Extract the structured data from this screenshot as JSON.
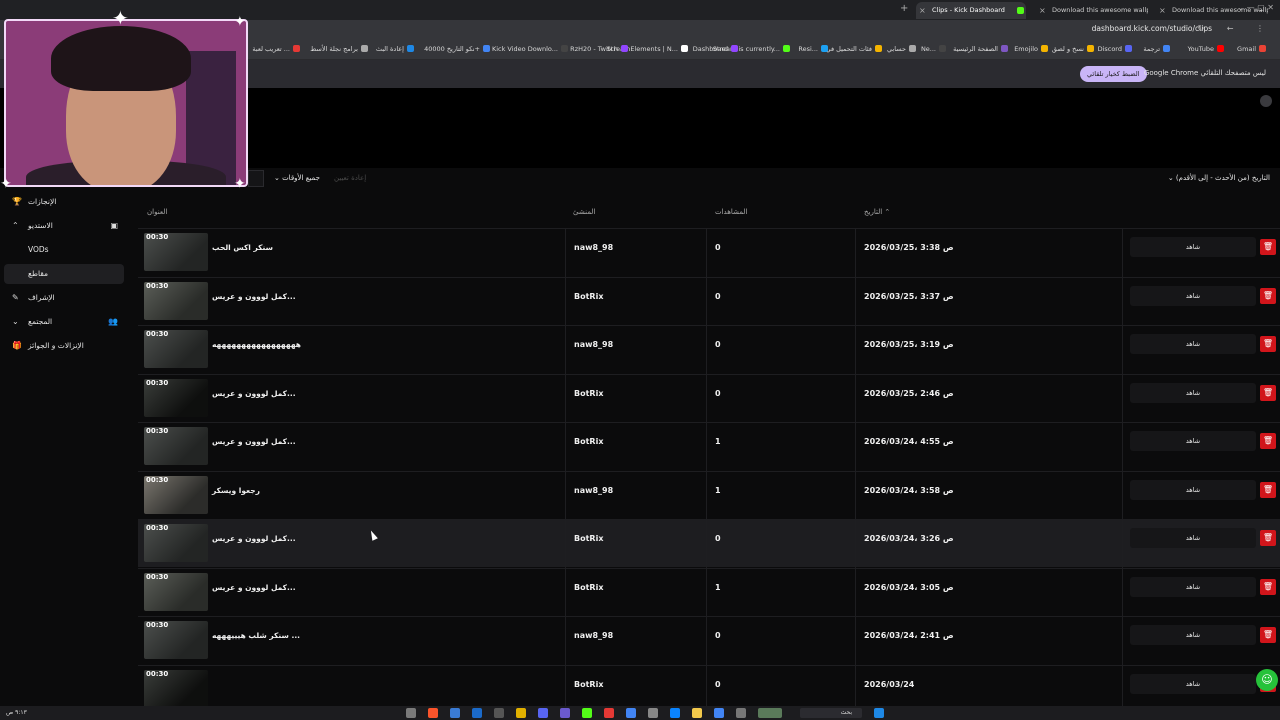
{
  "browser": {
    "tabs": [
      {
        "label": "Clips - Kick Dashboard",
        "active": true
      },
      {
        "label": "Download this awesome wallp",
        "active": false
      },
      {
        "label": "Download this awesome wallp",
        "active": false
      }
    ],
    "new_tab": "+",
    "window_controls": "⌄   —   ▢   ✕",
    "url": "dashboard.kick.com/studio/clips",
    "nav_icons": "↻ ← ⋮",
    "bookmarks": [
      "Gmail",
      "YouTube",
      "ترجمة",
      "Discord",
      "نسخ و لصق",
      "Emojilo",
      "الصفحة الرئيسية",
      "Ne...",
      "حسابي",
      "فئات التحميل في",
      "Resi...",
      "Stream is currently...",
      "Dashboard",
      "StreamElements | N...",
      "RzH20 - Twitch",
      "Kick Video Downlo...",
      "نكو التاريخ 40000+",
      "إعادة البث",
      "برامج نجلة الأسط",
      "تعريب لعبة ..."
    ],
    "infobar": {
      "button": "الضبط كخيار تلقائي",
      "text": "Google Chrome ليس متصفحك التلقائي"
    }
  },
  "filters": {
    "all_times": "جميع الأوقات",
    "disabled": "إعادة تعيين",
    "sort": "التاريخ (من الأحدث - إلى الأقدم)"
  },
  "sidebar": {
    "items": [
      {
        "label": "الإنجازات",
        "icon": "trophy-icon"
      },
      {
        "label": "الاستديو",
        "icon": "chevron-up-icon"
      },
      {
        "label": "VODs",
        "icon": ""
      },
      {
        "label": "مقاطع",
        "icon": ""
      },
      {
        "label": "الإشراف",
        "icon": "wrench-icon"
      },
      {
        "label": "المجتمع",
        "icon": "chevron-down-icon"
      },
      {
        "label": "الإنزالات و الجوائز",
        "icon": "gift-icon"
      }
    ]
  },
  "table": {
    "headers": {
      "title": "العنوان",
      "creator": "المنشئ",
      "views": "المشاهدات",
      "date": "التاريخ"
    },
    "watch_label": "شاهد",
    "delete_icon": "🗑",
    "rows": [
      {
        "duration": "00:30",
        "title": "سنكر اكس الحب",
        "creator": "naw8_98",
        "views": "0",
        "date": "2026/03/25، 3:38 ص"
      },
      {
        "duration": "00:30",
        "title": "كمل لووون و عريس...",
        "creator": "BotRix",
        "views": "0",
        "date": "2026/03/25، 3:37 ص"
      },
      {
        "duration": "00:30",
        "title": "هههههههههههههههههه",
        "creator": "naw8_98",
        "views": "0",
        "date": "2026/03/25، 3:19 ص"
      },
      {
        "duration": "00:30",
        "title": "كمل لووون و عريس...",
        "creator": "BotRix",
        "views": "0",
        "date": "2026/03/25، 2:46 ص"
      },
      {
        "duration": "00:30",
        "title": "كمل لووون و عريس...",
        "creator": "BotRix",
        "views": "1",
        "date": "2026/03/24، 4:55 ص"
      },
      {
        "duration": "00:30",
        "title": "رجعوا ويسكر",
        "creator": "naw8_98",
        "views": "1",
        "date": "2026/03/24، 3:58 ص"
      },
      {
        "duration": "00:30",
        "title": "كمل لووون و عريس...",
        "creator": "BotRix",
        "views": "0",
        "date": "2026/03/24، 3:26 ص"
      },
      {
        "duration": "00:30",
        "title": "كمل لووون و عريس...",
        "creator": "BotRix",
        "views": "1",
        "date": "2026/03/24، 3:05 ص"
      },
      {
        "duration": "00:30",
        "title": "سنكر شلب هيييهههه ...",
        "creator": "naw8_98",
        "views": "0",
        "date": "2026/03/24، 2:41 ص"
      },
      {
        "duration": "00:30",
        "title": "",
        "creator": "BotRix",
        "views": "0",
        "date": "2026/03/24"
      }
    ]
  },
  "help_icon": "☺",
  "taskbar": {
    "clock": "٩:١٣ ص",
    "search": "بحث"
  }
}
